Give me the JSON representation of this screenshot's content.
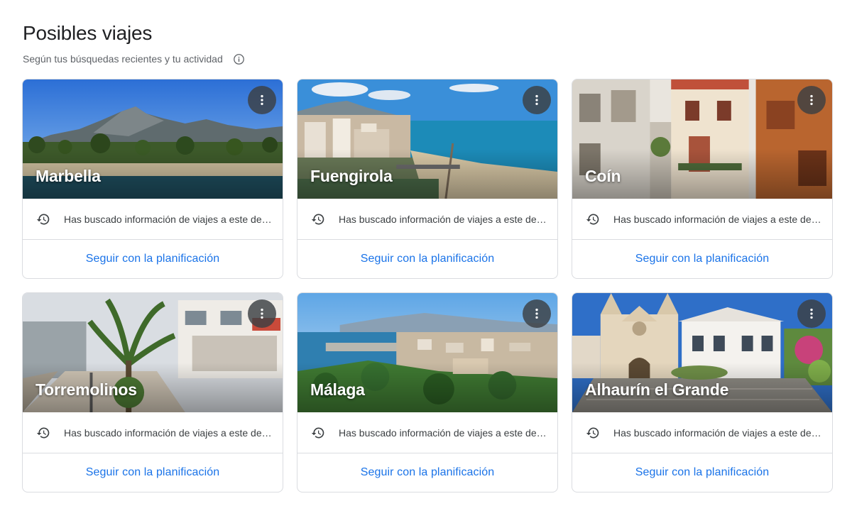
{
  "page": {
    "title": "Posibles viajes",
    "subtitle": "Según tus búsquedas recientes y tu actividad",
    "info_icon": "info-icon"
  },
  "cards": [
    {
      "name": "Marbella",
      "info": "Has buscado información de viajes a este destino",
      "action": "Seguir con la planificación",
      "image": "mountain-beach-scene"
    },
    {
      "name": "Fuengirola",
      "info": "Has buscado información de viajes a este destino",
      "action": "Seguir con la planificación",
      "image": "coastal-city-scene"
    },
    {
      "name": "Coín",
      "info": "Has buscado información de viajes a este destino",
      "action": "Seguir con la planificación",
      "image": "narrow-street-scene"
    },
    {
      "name": "Torremolinos",
      "info": "Has buscado información de viajes a este destino",
      "action": "Seguir con la planificación",
      "image": "promenade-scene"
    },
    {
      "name": "Málaga",
      "info": "Has buscado información de viajes a este destino",
      "action": "Seguir con la planificación",
      "image": "city-port-scene"
    },
    {
      "name": "Alhaurín el Grande",
      "info": "Has buscado información de viajes a este destino",
      "action": "Seguir con la planificación",
      "image": "church-plaza-scene"
    }
  ],
  "icons": {
    "menu": "more-vert-icon",
    "history": "history-icon"
  },
  "colors": {
    "accent": "#1a73e8",
    "border": "#dadce0",
    "text_secondary": "#5f6368"
  }
}
